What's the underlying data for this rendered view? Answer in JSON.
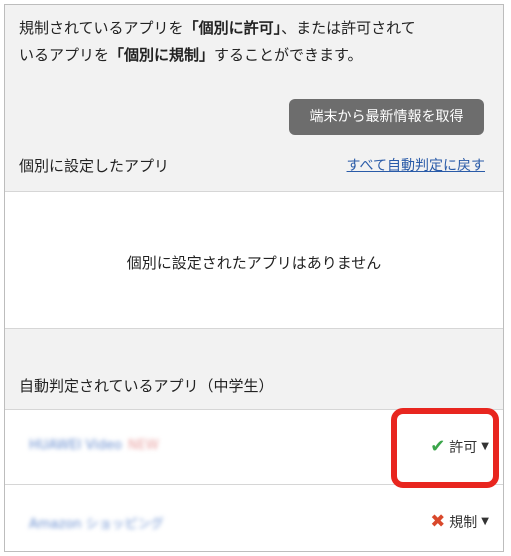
{
  "intro": {
    "line1_pre": "規制されているアプリを",
    "line1_em1": "「個別に許可」",
    "line1_post": "、または許可されて",
    "line2_pre": "いるアプリを",
    "line2_em2": "「個別に規制」",
    "line2_post": "することができます。"
  },
  "fetch_button": "端末から最新情報を取得",
  "individual": {
    "title": "個別に設定したアプリ",
    "reset_link": "すべて自動判定に戻す",
    "empty_text": "個別に設定されたアプリはありません"
  },
  "auto": {
    "title": "自動判定されているアプリ（中学生）",
    "apps": [
      {
        "name": "HUAWEI Video",
        "tag": "NEW",
        "status_label": "許可",
        "status_icon": "check-icon",
        "status_color": "#3aa54a"
      },
      {
        "name": "Amazon ショッピング",
        "tag": "",
        "status_label": "規制",
        "status_icon": "x-icon",
        "status_color": "#d9482b"
      }
    ]
  },
  "colors": {
    "accent_link": "#2a5ba8",
    "highlight": "#e8261f",
    "button_bg": "#6d6d6d"
  }
}
